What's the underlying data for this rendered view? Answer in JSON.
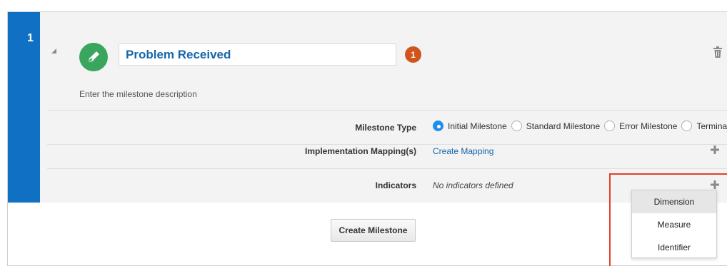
{
  "milestone": {
    "index": "1",
    "title": "Problem Received",
    "badge_count": "1",
    "description": "Enter the milestone description"
  },
  "milestone_type": {
    "label": "Milestone Type",
    "options": [
      "Initial Milestone",
      "Standard Milestone",
      "Error Milestone",
      "Terminal"
    ],
    "selected": "Initial Milestone"
  },
  "implementation": {
    "label": "Implementation Mapping(s)",
    "link": "Create Mapping"
  },
  "indicators": {
    "label": "Indicators",
    "empty_text": "No indicators defined"
  },
  "actions": {
    "create_milestone": "Create Milestone"
  },
  "indicator_menu": {
    "items": [
      "Dimension",
      "Measure",
      "Identifier"
    ],
    "hovered": "Dimension"
  },
  "colors": {
    "index_bar": "#1070c4",
    "milestone_icon": "#3aa55c",
    "badge": "#d1541a",
    "title_text": "#1466a8",
    "radio_selected": "#1e8ef0",
    "highlight_border": "#e2402b"
  },
  "icons": {
    "milestone": "pencil-icon",
    "delete": "trash-icon",
    "add": "plus-icon",
    "collapse": "triangle-collapse-icon"
  }
}
